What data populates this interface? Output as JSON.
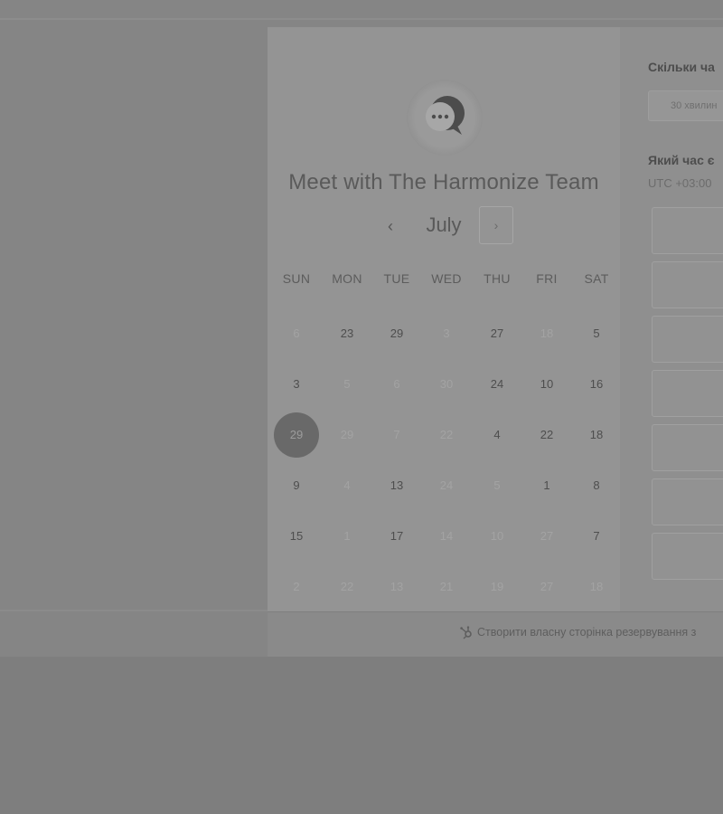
{
  "header": {
    "title": "Meet with The Harmonize Team",
    "avatar_icon": "chat-bubble-icon"
  },
  "calendar": {
    "month": "July",
    "prev_label": "‹",
    "next_label": "›",
    "weekdays": [
      "SUN",
      "MON",
      "TUE",
      "WED",
      "THU",
      "FRI",
      "SAT"
    ],
    "weeks": [
      [
        {
          "d": "6",
          "a": false
        },
        {
          "d": "23",
          "a": true
        },
        {
          "d": "29",
          "a": true
        },
        {
          "d": "3",
          "a": false
        },
        {
          "d": "27",
          "a": true
        },
        {
          "d": "18",
          "a": false
        },
        {
          "d": "5",
          "a": true
        }
      ],
      [
        {
          "d": "3",
          "a": true
        },
        {
          "d": "5",
          "a": false
        },
        {
          "d": "6",
          "a": false
        },
        {
          "d": "30",
          "a": false
        },
        {
          "d": "24",
          "a": true
        },
        {
          "d": "10",
          "a": true
        },
        {
          "d": "16",
          "a": true
        }
      ],
      [
        {
          "d": "29",
          "a": true,
          "selected": true
        },
        {
          "d": "29",
          "a": false
        },
        {
          "d": "7",
          "a": false
        },
        {
          "d": "22",
          "a": false
        },
        {
          "d": "4",
          "a": true
        },
        {
          "d": "22",
          "a": true
        },
        {
          "d": "18",
          "a": true
        }
      ],
      [
        {
          "d": "9",
          "a": true
        },
        {
          "d": "4",
          "a": false
        },
        {
          "d": "13",
          "a": true
        },
        {
          "d": "24",
          "a": false
        },
        {
          "d": "5",
          "a": false
        },
        {
          "d": "1",
          "a": true
        },
        {
          "d": "8",
          "a": true
        }
      ],
      [
        {
          "d": "15",
          "a": true
        },
        {
          "d": "1",
          "a": false
        },
        {
          "d": "17",
          "a": true
        },
        {
          "d": "14",
          "a": false
        },
        {
          "d": "10",
          "a": false
        },
        {
          "d": "27",
          "a": false
        },
        {
          "d": "7",
          "a": true
        }
      ],
      [
        {
          "d": "2",
          "a": false
        },
        {
          "d": "22",
          "a": false
        },
        {
          "d": "13",
          "a": false
        },
        {
          "d": "21",
          "a": false
        },
        {
          "d": "19",
          "a": false
        },
        {
          "d": "27",
          "a": false
        },
        {
          "d": "18",
          "a": false
        }
      ]
    ]
  },
  "right_panel": {
    "duration_question": "Скільки ча",
    "duration_option": "30 хвилин",
    "time_question": "Який час є",
    "timezone": "UTC +03:00",
    "slot_count_visible": 7
  },
  "footer": {
    "link_text": "Створити власну сторінка резервування з",
    "link_icon": "hubspot-sprocket-icon"
  },
  "colors": {
    "overlay_background": "#858585",
    "selected_day": "#696969"
  }
}
